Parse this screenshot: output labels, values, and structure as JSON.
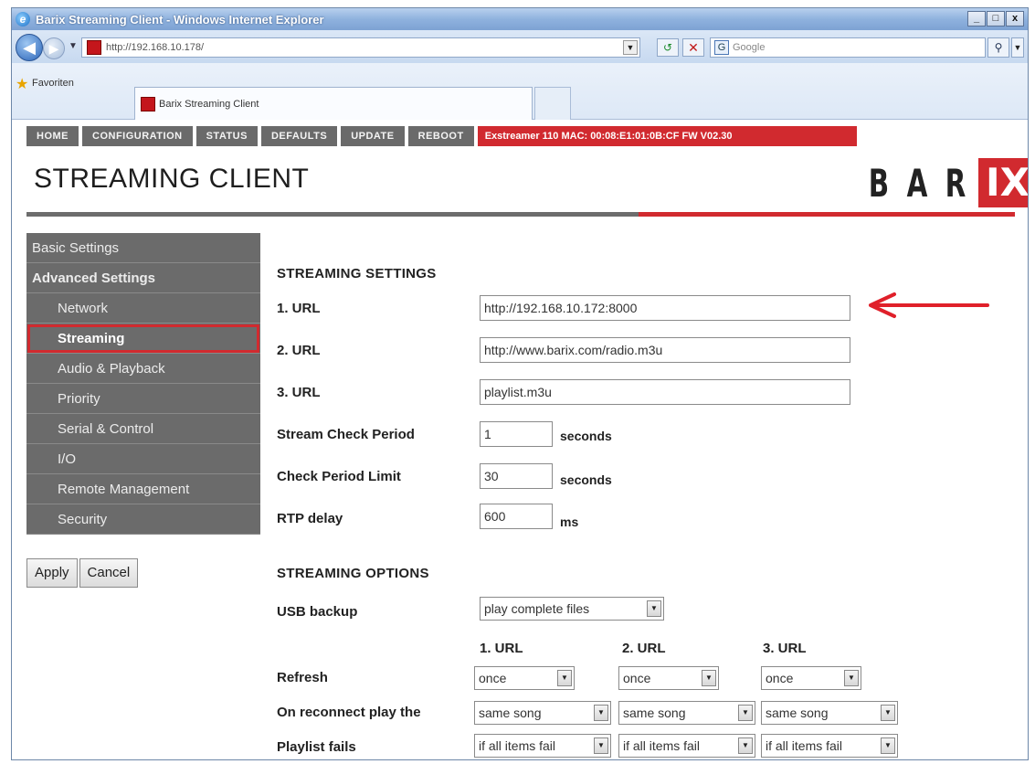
{
  "window": {
    "title": "Barix Streaming Client - Windows Internet Explorer",
    "controls": [
      "_",
      "□",
      "x"
    ]
  },
  "addressbar": {
    "url": "http://192.168.10.178/",
    "search_placeholder": "Google"
  },
  "favorites": {
    "label": "Favoriten",
    "tab_title": "Barix Streaming Client"
  },
  "topnav": {
    "items": [
      "HOME",
      "CONFIGURATION",
      "STATUS",
      "DEFAULTS",
      "UPDATE",
      "REBOOT"
    ],
    "device_info": "Exstreamer 110   MAC: 00:08:E1:01:0B:CF  FW V02.30"
  },
  "header": {
    "title": "STREAMING CLIENT",
    "logo_letters": [
      "B",
      "A",
      "R"
    ],
    "logo_highlight": "IX"
  },
  "sidebar": {
    "items": [
      {
        "label": "Basic Settings"
      },
      {
        "label": "Advanced Settings"
      },
      {
        "label": "Network"
      },
      {
        "label": "Streaming"
      },
      {
        "label": "Audio & Playback"
      },
      {
        "label": "Priority"
      },
      {
        "label": "Serial & Control"
      },
      {
        "label": "I/O"
      },
      {
        "label": "Remote Management"
      },
      {
        "label": "Security"
      }
    ]
  },
  "buttons": {
    "apply": "Apply",
    "cancel": "Cancel"
  },
  "streaming_settings": {
    "title": "STREAMING SETTINGS",
    "url1_label": "1. URL",
    "url1_value": "http://192.168.10.172:8000",
    "url2_label": "2. URL",
    "url2_value": "http://www.barix.com/radio.m3u",
    "url3_label": "3. URL",
    "url3_value": "playlist.m3u",
    "check_period_label": "Stream Check Period",
    "check_period_value": "1",
    "check_period_unit": "seconds",
    "check_limit_label": "Check Period Limit",
    "check_limit_value": "30",
    "check_limit_unit": "seconds",
    "rtp_label": "RTP delay",
    "rtp_value": "600",
    "rtp_unit": "ms"
  },
  "streaming_options": {
    "title": "STREAMING OPTIONS",
    "usb_label": "USB backup",
    "usb_value": "play complete files",
    "col_headers": [
      "1. URL",
      "2. URL",
      "3. URL"
    ],
    "refresh_label": "Refresh",
    "refresh_values": [
      "once",
      "once",
      "once"
    ],
    "reconnect_label": "On reconnect play the",
    "reconnect_values": [
      "same song",
      "same song",
      "same song"
    ],
    "playlist_label": "Playlist fails",
    "playlist_values": [
      "if all items fail",
      "if all items fail",
      "if all items fail"
    ]
  },
  "colors": {
    "brand_red": "#d12a2f",
    "nav_gray": "#6a6a6a"
  }
}
